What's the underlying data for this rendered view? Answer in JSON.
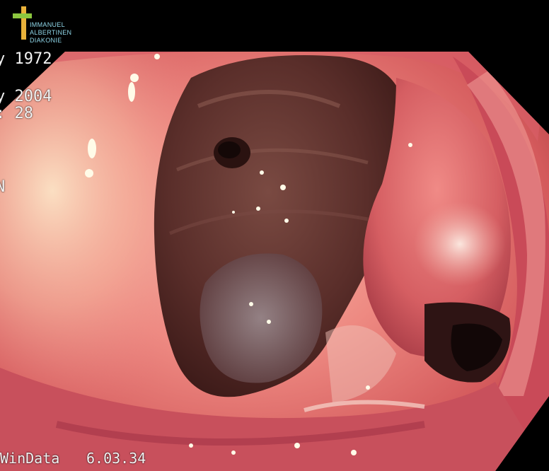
{
  "logo": {
    "line1": "IMMANUEL",
    "line2": "ALBERTINEN",
    "line3": "DIAKONIE",
    "icon": "cross-icon",
    "colors": {
      "cross_vertical": "#e9b23a",
      "cross_horizontal": "#8cc63f",
      "text": "#8fd6e8"
    }
  },
  "overlay": {
    "birth_date": "y 1972",
    "exam_date": "y 2004",
    "time": ": 28",
    "marker": "N"
  },
  "footer": {
    "software": "WinData",
    "timestamp": "6.03.34"
  },
  "scene": {
    "description_colors": {
      "mucosa": "#e8686a",
      "lumen_dark": "#4a2220",
      "background": "#000000"
    }
  }
}
